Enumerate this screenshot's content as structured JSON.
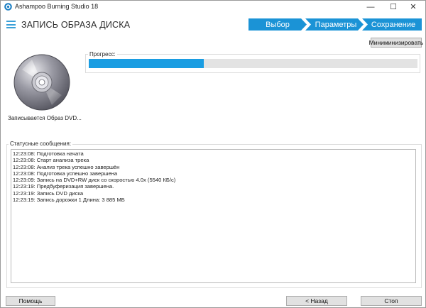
{
  "window": {
    "title": "Ashampoo Burning Studio 18",
    "controls": {
      "minimize": "—",
      "maximize": "☐",
      "close": "✕"
    }
  },
  "header": {
    "page_title": "ЗАПИСЬ ОБРАЗА ДИСКА",
    "steps": [
      {
        "label": "Выбор"
      },
      {
        "label": "Параметры"
      },
      {
        "label": "Сохранение"
      }
    ]
  },
  "toolbar": {
    "minimize_label": "Миниминизировать"
  },
  "disc": {
    "caption": "Записывается Образ DVD..."
  },
  "progress": {
    "label": "Прогресс:",
    "percent": 35
  },
  "status": {
    "label": "Статусные сообщения:",
    "messages": [
      "12:23:08: Подготовка начата",
      "12:23:08: Старт анализа трека",
      "12:23:08: Анализ трека успешно завершён",
      "12:23:08: Подготовка успешно завершена",
      "12:23:09: Запись на DVD+RW диск со скоростью 4.0x (5540 КБ/с)",
      "12:23:19: Предбуферизация завершена.",
      "12:23:19: Запись DVD диска",
      "12:23:19: Запись дорожки 1 Длина: 3 885 МБ"
    ]
  },
  "footer": {
    "help_label": "Помощь",
    "back_label": "< Назад",
    "stop_label": "Стоп"
  },
  "colors": {
    "accent": "#1b93d6",
    "progress": "#1a9de2"
  }
}
